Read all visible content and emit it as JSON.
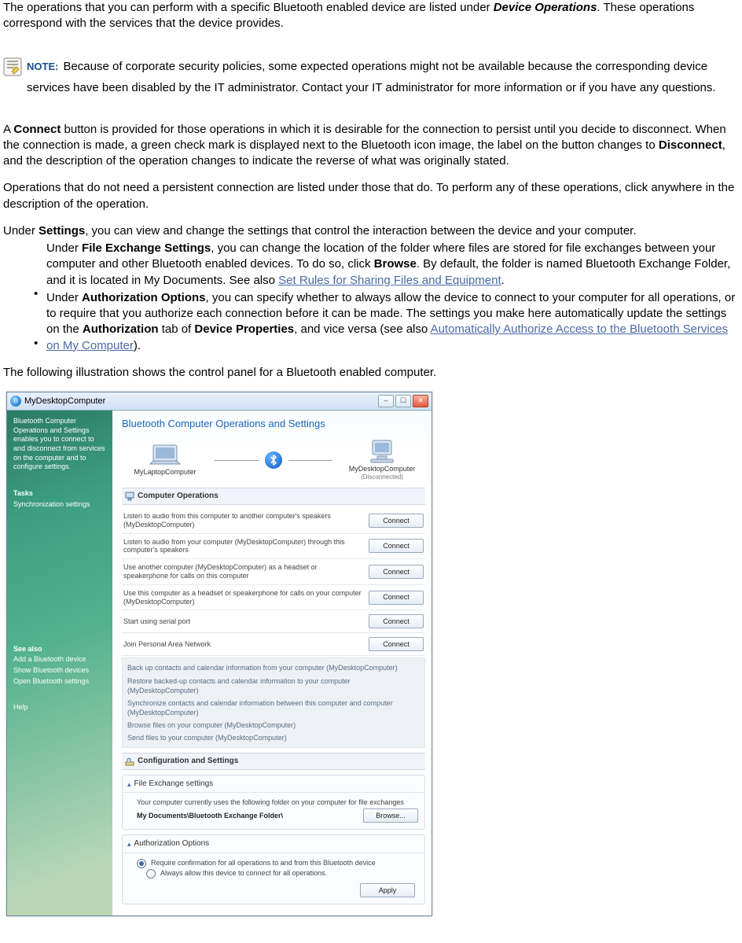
{
  "doc": {
    "p1_a": "The operations that you can perform with a specific Bluetooth enabled device are listed under ",
    "p1_b": "Device Operations",
    "p1_c": ". These operations correspond with the services that the device provides.",
    "note_label": "NOTE:",
    "note_text": "Because of corporate security policies, some expected operations might not be available because the corresponding device services have been disabled by the IT administrator. Contact your IT administrator for more information or if you have any questions.",
    "p2_a": "A ",
    "p2_b": "Connect",
    "p2_c": " button is provided for those operations in which it is desirable for the connection to persist until you decide to disconnect. When the connection is made, a green check mark is displayed next to the Bluetooth icon image, the label on the button changes to ",
    "p2_d": "Disconnect",
    "p2_e": ", and the description of the operation changes to indicate the reverse of what was originally stated.",
    "p3": "Operations that do not need a persistent connection are listed under those that do. To perform any of these operations, click anywhere in the description of the operation.",
    "p4_a": "Under ",
    "p4_b": "Settings",
    "p4_c": ", you can view and change the settings that control the interaction between the device and your computer.",
    "li1_a": "Under ",
    "li1_b": "File Exchange Settings",
    "li1_c": ", you can change the location of the folder where files are stored for file exchanges between your computer and other Bluetooth enabled devices. To do so, click ",
    "li1_d": "Browse",
    "li1_e": ". By default, the folder is named Bluetooth Exchange Folder, and it is located in My Documents. See also ",
    "li1_link": "Set Rules for Sharing Files and Equipment",
    "li1_f": ".",
    "li2_a": "Under ",
    "li2_b": "Authorization Options",
    "li2_c": ", you can specify whether to always allow the device to connect to your computer for all operations, or to require that you authorize each connection before it can be made. The settings you make here automatically update the settings on the ",
    "li2_d": "Authorization",
    "li2_e": " tab of ",
    "li2_f": "Device Properties",
    "li2_g": ", and vice versa (see also ",
    "li2_link": "Automatically Authorize Access to the Bluetooth Services on My Computer",
    "li2_h": ").",
    "p5": "The following illustration shows the control panel for a Bluetooth enabled computer."
  },
  "dlg": {
    "title": "MyDesktopComputer",
    "side_intro": "Bluetooth Computer Operations and Settings enables you to connect to and disconnect from services on the computer and to configure settings.",
    "side_tasks_hd": "Tasks",
    "side_task1": "Synchronization settings",
    "side_see_hd": "See also",
    "side_see1": "Add a Bluetooth device",
    "side_see2": "Show Bluetooth devices",
    "side_see3": "Open Bluetooth settings",
    "side_help": "Help",
    "main_title": "Bluetooth Computer Operations and Settings",
    "dev_left": "MyLaptopComputer",
    "dev_right": "MyDesktopComputer",
    "dev_right_sub": "(Disconnected)",
    "sec_ops": "Computer Operations",
    "ops": [
      "Listen to audio from this computer to another computer's speakers (MyDesktopComputer)",
      "Listen to audio from your computer (MyDesktopComputer) through this computer's speakers",
      "Use another computer (MyDesktopComputer) as a headset or speakerphone for calls on this computer",
      "Use this computer as a headset or speakerphone for calls on your computer (MyDesktopComputer)",
      "Start using serial port",
      "Join Personal Area Network"
    ],
    "connect": "Connect",
    "quiet": [
      "Back up contacts and calendar information from your computer (MyDesktopComputer)",
      "Restore backed-up contacts and calendar information to your computer (MyDesktopComputer)",
      "Synchronize contacts and calendar information between this computer and computer (MyDesktopComputer)",
      "Browse files on your computer (MyDesktopComputer)",
      "Send files to your computer (MyDesktopComputer)"
    ],
    "sec_cfg": "Configuration and Settings",
    "fx_hd": "File Exchange settings",
    "fx_line": "Your computer currently uses the following folder on your computer for file exchanges",
    "fx_path": "My Documents\\Bluetooth Exchange Folder\\",
    "browse": "Browse...",
    "auth_hd": "Authorization Options",
    "auth_r1": "Require confirmation for all operations to and from this Bluetooth device",
    "auth_r2": "Always allow this device to connect for all operations.",
    "apply": "Apply"
  }
}
